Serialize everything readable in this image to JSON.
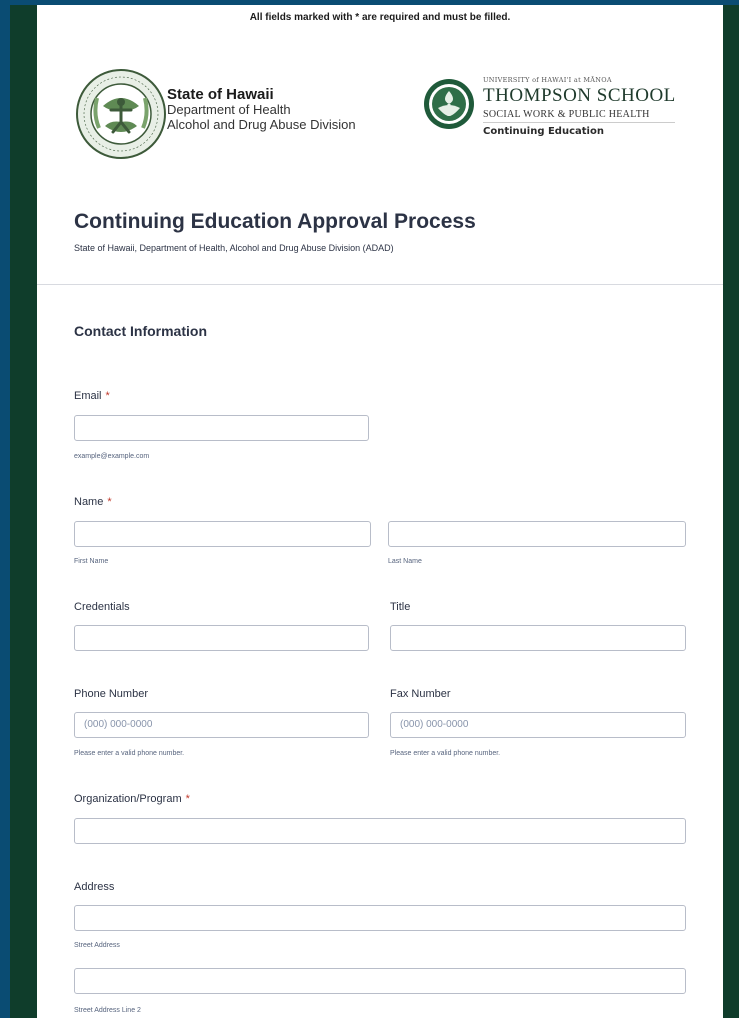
{
  "required_note": "All fields marked with * are required and must be filled.",
  "logos": {
    "hawaii": {
      "title": "State of Hawaii",
      "line1": "Department of Health",
      "line2": "Alcohol and Drug Abuse Division",
      "seal_color": "#3d5a3a"
    },
    "uh": {
      "top": "UNIVERSITY of HAWAI'I at MĀNOA",
      "main": "THOMPSON SCHOOL",
      "sub": "SOCIAL WORK & PUBLIC HEALTH",
      "ce": "Continuing Education",
      "seal_color": "#1f5a3a"
    }
  },
  "form": {
    "title": "Continuing Education Approval Process",
    "subtitle": "State of Hawaii, Department of Health, Alcohol and Drug Abuse Division (ADAD)"
  },
  "section": {
    "title": "Contact Information"
  },
  "required_marker": "*",
  "fields": {
    "email": {
      "label": "Email",
      "value": "",
      "help": "example@example.com"
    },
    "name": {
      "label": "Name",
      "first_help": "First Name",
      "last_help": "Last Name"
    },
    "credentials": {
      "label": "Credentials",
      "value": ""
    },
    "title": {
      "label": "Title",
      "value": ""
    },
    "phone": {
      "label": "Phone Number",
      "placeholder": "(000) 000-0000",
      "help": "Please enter a valid phone number."
    },
    "fax": {
      "label": "Fax Number",
      "placeholder": "(000) 000-0000",
      "help": "Please enter a valid phone number."
    },
    "organization": {
      "label": "Organization/Program",
      "value": ""
    },
    "address": {
      "label": "Address",
      "line1_help": "Street Address",
      "line2_help": "Street Address Line 2"
    }
  }
}
